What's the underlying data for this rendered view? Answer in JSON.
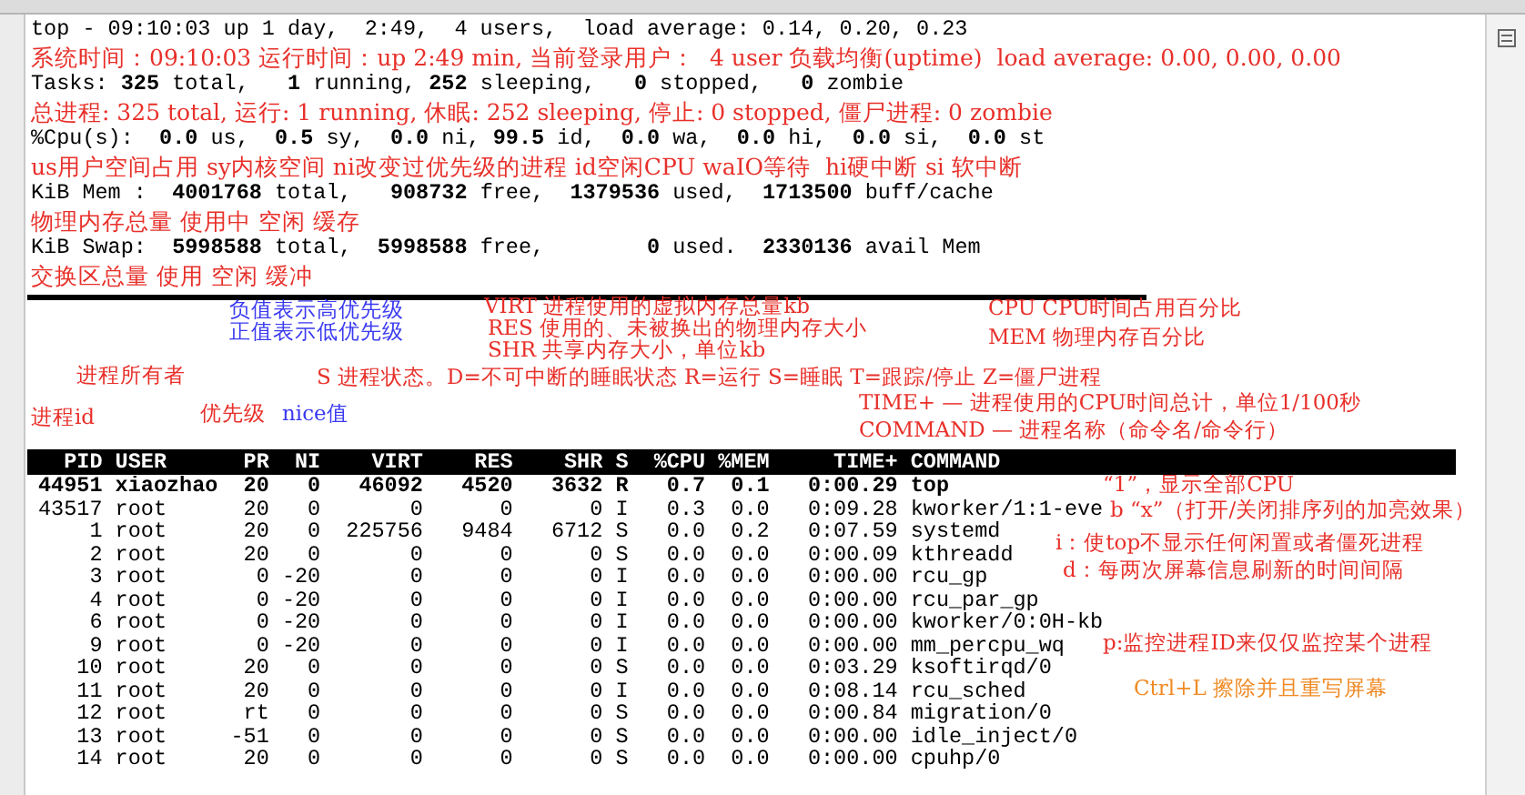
{
  "summary_lines": [
    {
      "kind": "terminal",
      "text": "top - 09:10:03 up 1 day,  2:49,  4 users,  load average: 0.14, 0.20, 0.23"
    },
    {
      "kind": "note",
      "text": "系统时间：09:10:03 运行时间：up 2:49 min, 当前登录用户：  4 user 负载均衡(uptime)  load average: 0.00, 0.00, 0.00"
    },
    {
      "kind": "terminal",
      "text": "Tasks: **325** total,   **1** running, **252** sleeping,   **0** stopped,   **0** zombie"
    },
    {
      "kind": "note",
      "text": "总进程: 325 total, 运行: 1 running, 休眠: 252 sleeping, 停止: 0 stopped, 僵尸进程: 0 zombie"
    },
    {
      "kind": "terminal",
      "text": "%Cpu(s):  **0.0** us,  **0.5** sy,  **0.0** ni, **99.5** id,  **0.0** wa,  **0.0** hi,  **0.0** si,  **0.0** st"
    },
    {
      "kind": "note",
      "text": "us用户空间占用 sy内核空间 ni改变过优先级的进程 id空闲CPU waIO等待  hi硬中断 si 软中断"
    },
    {
      "kind": "terminal",
      "text": "KiB Mem :  **4001768** total,   **908732** free,  **1379536** used,  **1713500** buff/cache"
    },
    {
      "kind": "note",
      "text": "物理内存总量 使用中 空闲 缓存"
    },
    {
      "kind": "terminal",
      "text": "KiB Swap:  **5998588** total,  **5998588** free,        **0** used.  **2330136** avail Mem"
    },
    {
      "kind": "note",
      "text": "交换区总量 使用 空闲 缓冲"
    }
  ],
  "column_notes": [
    {
      "text": "负值表示高优先级",
      "color": "#3a3af0"
    },
    {
      "text": "VIRT 进程使用的虚拟内存总量kb",
      "color": "#e8302a"
    },
    {
      "text": "CPU CPU时间占用百分比",
      "color": "#e8302a"
    },
    {
      "text": "正值表示低优先级",
      "color": "#3a3af0"
    },
    {
      "text": "RES 使用的、未被换出的物理内存大小",
      "color": "#e8302a"
    },
    {
      "text": "MEM 物理内存百分比",
      "color": "#e8302a"
    },
    {
      "text": "SHR 共享内存大小，单位kb",
      "color": "#e8302a"
    },
    {
      "text": "进程所有者",
      "color": "#e8302a"
    },
    {
      "text": "S 进程状态。D=不可中断的睡眠状态 R=运行 S=睡眠 T=跟踪/停止 Z=僵尸进程",
      "color": "#e8302a"
    },
    {
      "text": "TIME+ — 进程使用的CPU时间总计，单位1/100秒",
      "color": "#e8302a"
    },
    {
      "text": "进程id",
      "color": "#e8302a"
    },
    {
      "text": "优先级",
      "color": "#e8302a"
    },
    {
      "text": "nice值",
      "color": "#3a3af0"
    },
    {
      "text": "COMMAND — 进程名称（命令名/命令行）",
      "color": "#e8302a"
    }
  ],
  "table": {
    "columns": [
      "PID",
      "USER",
      "PR",
      "NI",
      "VIRT",
      "RES",
      "SHR",
      "S",
      "%CPU",
      "%MEM",
      "TIME+",
      "COMMAND"
    ],
    "rows": [
      {
        "highlighted": true,
        "cells": [
          "44951",
          "xiaozhao",
          "20",
          "0",
          "46092",
          "4520",
          "3632",
          "R",
          "0.7",
          "0.1",
          "0:00.29",
          "top"
        ]
      },
      {
        "highlighted": false,
        "cells": [
          "43517",
          "root",
          "20",
          "0",
          "0",
          "0",
          "0",
          "I",
          "0.3",
          "0.0",
          "0:09.28",
          "kworker/1:1-eve"
        ]
      },
      {
        "highlighted": false,
        "cells": [
          "1",
          "root",
          "20",
          "0",
          "225756",
          "9484",
          "6712",
          "S",
          "0.0",
          "0.2",
          "0:07.59",
          "systemd"
        ]
      },
      {
        "highlighted": false,
        "cells": [
          "2",
          "root",
          "20",
          "0",
          "0",
          "0",
          "0",
          "S",
          "0.0",
          "0.0",
          "0:00.09",
          "kthreadd"
        ]
      },
      {
        "highlighted": false,
        "cells": [
          "3",
          "root",
          "0",
          "-20",
          "0",
          "0",
          "0",
          "I",
          "0.0",
          "0.0",
          "0:00.00",
          "rcu_gp"
        ]
      },
      {
        "highlighted": false,
        "cells": [
          "4",
          "root",
          "0",
          "-20",
          "0",
          "0",
          "0",
          "I",
          "0.0",
          "0.0",
          "0:00.00",
          "rcu_par_gp"
        ]
      },
      {
        "highlighted": false,
        "cells": [
          "6",
          "root",
          "0",
          "-20",
          "0",
          "0",
          "0",
          "I",
          "0.0",
          "0.0",
          "0:00.00",
          "kworker/0:0H-kb"
        ]
      },
      {
        "highlighted": false,
        "cells": [
          "9",
          "root",
          "0",
          "-20",
          "0",
          "0",
          "0",
          "I",
          "0.0",
          "0.0",
          "0:00.00",
          "mm_percpu_wq"
        ]
      },
      {
        "highlighted": false,
        "cells": [
          "10",
          "root",
          "20",
          "0",
          "0",
          "0",
          "0",
          "S",
          "0.0",
          "0.0",
          "0:03.29",
          "ksoftirqd/0"
        ]
      },
      {
        "highlighted": false,
        "cells": [
          "11",
          "root",
          "20",
          "0",
          "0",
          "0",
          "0",
          "I",
          "0.0",
          "0.0",
          "0:08.14",
          "rcu_sched"
        ]
      },
      {
        "highlighted": false,
        "cells": [
          "12",
          "root",
          "rt",
          "0",
          "0",
          "0",
          "0",
          "S",
          "0.0",
          "0.0",
          "0:00.84",
          "migration/0"
        ]
      },
      {
        "highlighted": false,
        "cells": [
          "13",
          "root",
          "-51",
          "0",
          "0",
          "0",
          "0",
          "S",
          "0.0",
          "0.0",
          "0:00.00",
          "idle_inject/0"
        ]
      },
      {
        "highlighted": false,
        "cells": [
          "14",
          "root",
          "20",
          "0",
          "0",
          "0",
          "0",
          "S",
          "0.0",
          "0.0",
          "0:00.00",
          "cpuhp/0"
        ]
      }
    ]
  },
  "key_notes": [
    {
      "text": "“1”，显示全部CPU",
      "color": "#e8302a"
    },
    {
      "text": "b “x”（打开/关闭排序列的加亮效果）",
      "color": "#e8302a"
    },
    {
      "text": "i：使top不显示任何闲置或者僵死进程",
      "color": "#e8302a"
    },
    {
      "text": "d：每两次屏幕信息刷新的时间间隔",
      "color": "#e8302a"
    },
    {
      "text": "p:监控进程ID来仅仅监控某个进程",
      "color": "#e8302a"
    },
    {
      "text": "Ctrl+L 擦除并且重写屏幕",
      "color": "#f08a24"
    }
  ]
}
